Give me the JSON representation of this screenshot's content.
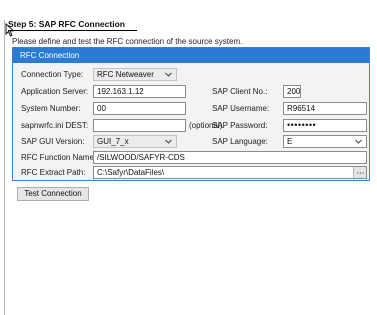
{
  "step": {
    "title": "Step 5:  SAP RFC Connection",
    "description": "Please define and test the RFC connection of the source system."
  },
  "panel": {
    "header": "RFC Connection",
    "connection_type": {
      "label": "Connection Type:",
      "value": "RFC Netweaver"
    },
    "application_server": {
      "label": "Application Server:",
      "value": "192.163.1.12"
    },
    "system_number": {
      "label": "System Number:",
      "value": "00"
    },
    "sapnwrfc_dest": {
      "label": "sapnwrfc.ini DEST:",
      "value": "",
      "hint": "(optional)"
    },
    "sap_gui_version": {
      "label": "SAP GUI Version:",
      "value": "GUI_7_x"
    },
    "rfc_function_name": {
      "label": "RFC Function Name:",
      "value": "/SILWOOD/SAFYR-CDS"
    },
    "rfc_extract_path": {
      "label": "RFC Extract Path:",
      "value": "C:\\Safyr\\DataFiles\\"
    },
    "sap_client_no": {
      "label": "SAP Client No.:",
      "value": "200"
    },
    "sap_username": {
      "label": "SAP Username:",
      "value": "R96514"
    },
    "sap_password": {
      "label": "SAP Password:",
      "value": "••••••••"
    },
    "sap_language": {
      "label": "SAP Language:",
      "value": "E"
    }
  },
  "actions": {
    "test_connection": "Test Connection"
  },
  "colors": {
    "accent": "#2b7bd6",
    "panel_bg": "#f3f3f3"
  },
  "icons": [
    "cursor-icon",
    "chevron-down-icon",
    "ellipsis-icon"
  ]
}
